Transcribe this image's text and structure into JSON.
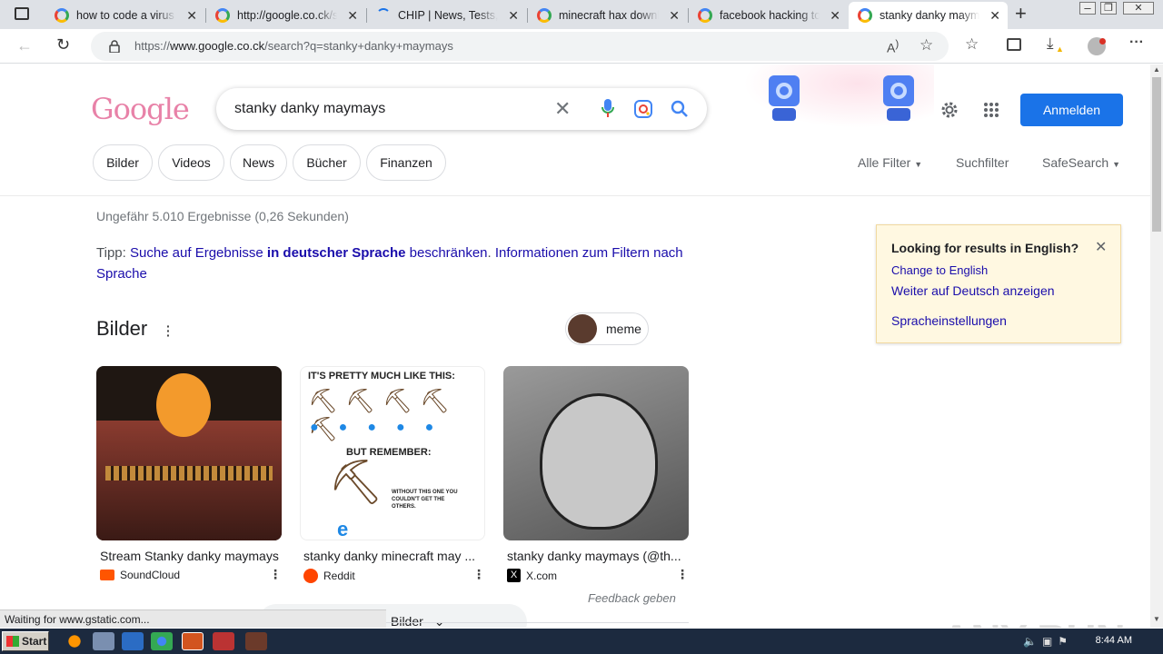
{
  "browser": {
    "tabs": [
      {
        "label": "how to code a virus in"
      },
      {
        "label": "http://google.co.ck/s"
      },
      {
        "label": "CHIP | News, Tests, D"
      },
      {
        "label": "minecraft hax downlo"
      },
      {
        "label": "facebook hacking too"
      },
      {
        "label": "stanky danky mayma"
      }
    ],
    "new_tab_glyph": "+",
    "url_prefix": "https://",
    "url_host": "www.google.co.ck",
    "url_path": "/search?q=stanky+danky+maymays",
    "window_controls": {
      "minimize": "–",
      "restore": "❐",
      "close": "✕"
    }
  },
  "search": {
    "query": "stanky danky maymays",
    "sign_in_label": "Anmelden",
    "logo_text": "Google"
  },
  "chips": [
    "Bilder",
    "Videos",
    "News",
    "Bücher",
    "Finanzen"
  ],
  "tools": {
    "all_filters": "Alle Filter",
    "search_filters": "Suchfilter",
    "safesearch": "SafeSearch"
  },
  "results": {
    "stats": "Ungefähr 5.010 Ergebnisse (0,26 Sekunden)",
    "tip_prefix": "Tipp: ",
    "tip_link1": "Suche auf Ergebnisse ",
    "tip_bold": "in deutscher Sprache",
    "tip_link2": " beschränken",
    "tip_sep": ". ",
    "tip_link3": "Informationen zum Filtern nach Sprache"
  },
  "images": {
    "heading": "Bilder",
    "chip_label": "meme",
    "items": [
      {
        "caption": "Stream Stanky danky maymays",
        "source": "SoundCloud"
      },
      {
        "caption": "stanky danky minecraft may ...",
        "source": "Reddit"
      },
      {
        "caption": "stanky danky maymays (@th...",
        "source": "X.com"
      }
    ],
    "meme_top": "IT'S PRETTY MUCH LIKE THIS:",
    "meme_mid": "BUT REMEMBER:",
    "meme_small": "WITHOUT THIS ONE YOU COULDN'T GET THE OTHERS.",
    "feedback": "Feedback geben",
    "more_label": "Bilder"
  },
  "lang_box": {
    "title": "Looking for results in English?",
    "link1": "Change to English",
    "link2": "Weiter auf Deutsch anzeigen",
    "link3": "Spracheinstellungen"
  },
  "status_text": "Waiting for www.gstatic.com...",
  "taskbar": {
    "start_label": "Start",
    "clock": "8:44 AM"
  },
  "watermark": "ANY RUN",
  "colors": {
    "link": "#1a0dab",
    "accent": "#1a73e8",
    "lang_box_bg": "#fff8e1",
    "taskbar": "#1c2a3f"
  }
}
